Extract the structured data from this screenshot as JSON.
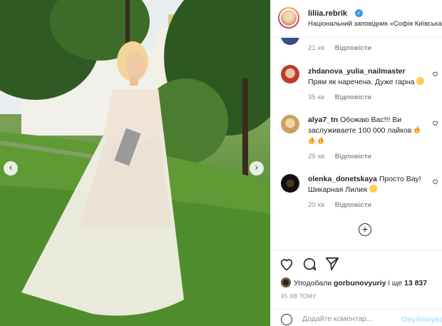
{
  "header": {
    "username": "liliia.rebrik",
    "location": "Національний заповідник «Софія Київська»"
  },
  "comments": [
    {
      "username": "",
      "text": "",
      "time": "21 хв",
      "reply_label": "Відповісти"
    },
    {
      "username": "zhdanova_yulia_nailmaster",
      "text": "Прям як наречена. Дуже гарна",
      "time": "35 хв",
      "reply_label": "Відповісти"
    },
    {
      "username": "alya7_tn",
      "text": "Обожаю Вас!!! Ви заслуживаете 100 000 лайков",
      "time": "29 хв",
      "reply_label": "Відповісти"
    },
    {
      "username": "olenka_donetskaya",
      "text": "Просто Вау! Шикарная Лилия",
      "time": "20 хв",
      "reply_label": "Відповісти"
    }
  ],
  "likes": {
    "prefix": "Уподобали",
    "user": "gorbunovyuriy",
    "middle": "і ще",
    "count": "13 837"
  },
  "time_ago": "45 ХВ ТОМУ",
  "add_comment": {
    "placeholder": "Додайте коментар...",
    "post_label": "Опублікувати"
  },
  "icons": {
    "like": "heart-icon",
    "comment": "comment-icon",
    "share": "share-icon",
    "verified": "verified-badge-icon"
  },
  "colors": {
    "verified": "#3897f0",
    "meta_text": "#8e8e8e",
    "post_button": "#b2dffc"
  }
}
